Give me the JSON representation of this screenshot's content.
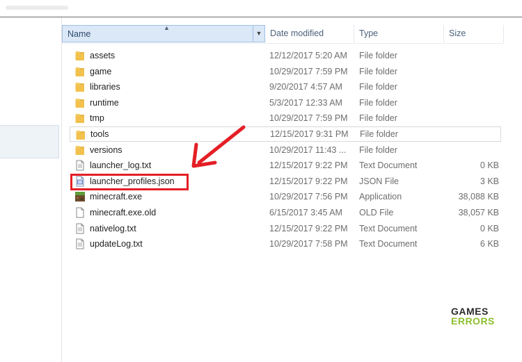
{
  "columns": {
    "name": "Name",
    "date_modified": "Date modified",
    "type": "Type",
    "size": "Size"
  },
  "files": [
    {
      "name": "assets",
      "date": "12/12/2017 5:20 AM",
      "type": "File folder",
      "size": "",
      "icon": "folder-icon"
    },
    {
      "name": "game",
      "date": "10/29/2017 7:59 PM",
      "type": "File folder",
      "size": "",
      "icon": "folder-icon"
    },
    {
      "name": "libraries",
      "date": "9/20/2017 4:57 AM",
      "type": "File folder",
      "size": "",
      "icon": "folder-icon"
    },
    {
      "name": "runtime",
      "date": "5/3/2017 12:33 AM",
      "type": "File folder",
      "size": "",
      "icon": "folder-icon"
    },
    {
      "name": "tmp",
      "date": "10/29/2017 7:59 PM",
      "type": "File folder",
      "size": "",
      "icon": "folder-icon"
    },
    {
      "name": "tools",
      "date": "12/15/2017 9:31 PM",
      "type": "File folder",
      "size": "",
      "icon": "folder-icon"
    },
    {
      "name": "versions",
      "date": "10/29/2017 11:43 ...",
      "type": "File folder",
      "size": "",
      "icon": "folder-icon"
    },
    {
      "name": "launcher_log.txt",
      "date": "12/15/2017 9:22 PM",
      "type": "Text Document",
      "size": "0 KB",
      "icon": "text-file-icon"
    },
    {
      "name": "launcher_profiles.json",
      "date": "12/15/2017 9:22 PM",
      "type": "JSON File",
      "size": "3 KB",
      "icon": "json-file-icon"
    },
    {
      "name": "minecraft.exe",
      "date": "10/29/2017 7:56 PM",
      "type": "Application",
      "size": "38,088 KB",
      "icon": "minecraft-app-icon"
    },
    {
      "name": "minecraft.exe.old",
      "date": "6/15/2017 3:45 AM",
      "type": "OLD File",
      "size": "38,057 KB",
      "icon": "blank-file-icon"
    },
    {
      "name": "nativelog.txt",
      "date": "12/15/2017 9:22 PM",
      "type": "Text Document",
      "size": "0 KB",
      "icon": "text-file-icon"
    },
    {
      "name": "updateLog.txt",
      "date": "10/29/2017 7:58 PM",
      "type": "Text Document",
      "size": "6 KB",
      "icon": "text-file-icon"
    }
  ],
  "annotation": {
    "highlight_color": "#e41f26",
    "highlighted_file": "launcher_profiles.json"
  },
  "watermark": {
    "line1": "GAMES",
    "line2": "ERRORS",
    "color1": "#2b2b2b",
    "color2": "#8dbf2e"
  }
}
